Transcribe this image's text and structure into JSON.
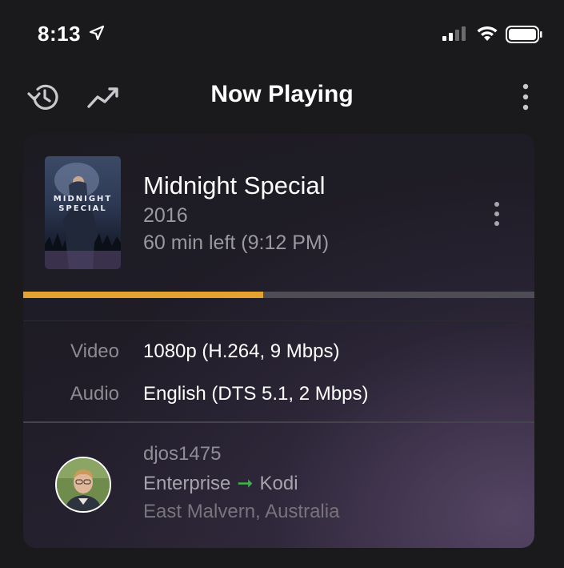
{
  "status": {
    "time": "8:13"
  },
  "nav": {
    "title": "Now Playing"
  },
  "session": {
    "poster_title_line1": "MIDNIGHT",
    "poster_title_line2": "SPECIAL",
    "title": "Midnight Special",
    "year": "2016",
    "time_left": "60 min left (9:12 PM)",
    "progress": 0.47
  },
  "streams": {
    "video_label": "Video",
    "video_value": "1080p (H.264, 9 Mbps)",
    "audio_label": "Audio",
    "audio_value": "English (DTS 5.1, 2 Mbps)"
  },
  "user": {
    "name": "djos1475",
    "server": "Enterprise",
    "player": "Kodi",
    "location": "East Malvern, Australia"
  },
  "colors": {
    "accent": "#e4a330",
    "arrow": "#3fb14b"
  }
}
